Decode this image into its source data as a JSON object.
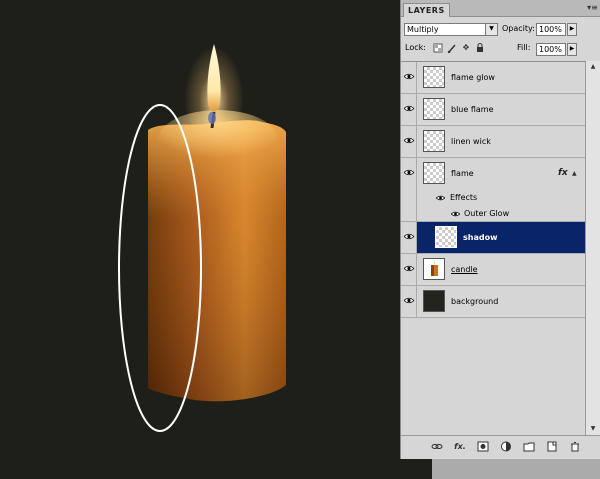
{
  "panel": {
    "tab_label": "LAYERS",
    "menu_icon": "panel-menu-icon",
    "blend_mode": "Multiply",
    "opacity_label": "Opacity:",
    "opacity_value": "100%",
    "lock_label": "Lock:",
    "fill_label": "Fill:",
    "fill_value": "100%"
  },
  "layers": [
    {
      "name": "flame glow",
      "visible": true,
      "thumbnail": "transparent"
    },
    {
      "name": "blue flame",
      "visible": true,
      "thumbnail": "transparent"
    },
    {
      "name": "linen wick",
      "visible": true,
      "thumbnail": "transparent"
    },
    {
      "name": "flame",
      "visible": true,
      "thumbnail": "transparent",
      "fx": "fx",
      "effects_label": "Effects",
      "effects": [
        "Outer Glow"
      ]
    },
    {
      "name": "shadow",
      "visible": true,
      "selected": true,
      "thumbnail": "transparent"
    },
    {
      "name": "candle",
      "visible": true,
      "thumbnail": "candle"
    },
    {
      "name": "background",
      "visible": true,
      "thumbnail": "dark"
    }
  ],
  "footer_icons": [
    "link-layers-icon",
    "fx-icon",
    "add-mask-icon",
    "adjustment-layer-icon",
    "new-group-icon",
    "new-layer-icon",
    "trash-icon"
  ],
  "colors": {
    "canvas_bg": "#1e1f19",
    "panel_bg": "#d6d6d6",
    "selected_row": "#0a246a",
    "candle": "#c87522"
  }
}
